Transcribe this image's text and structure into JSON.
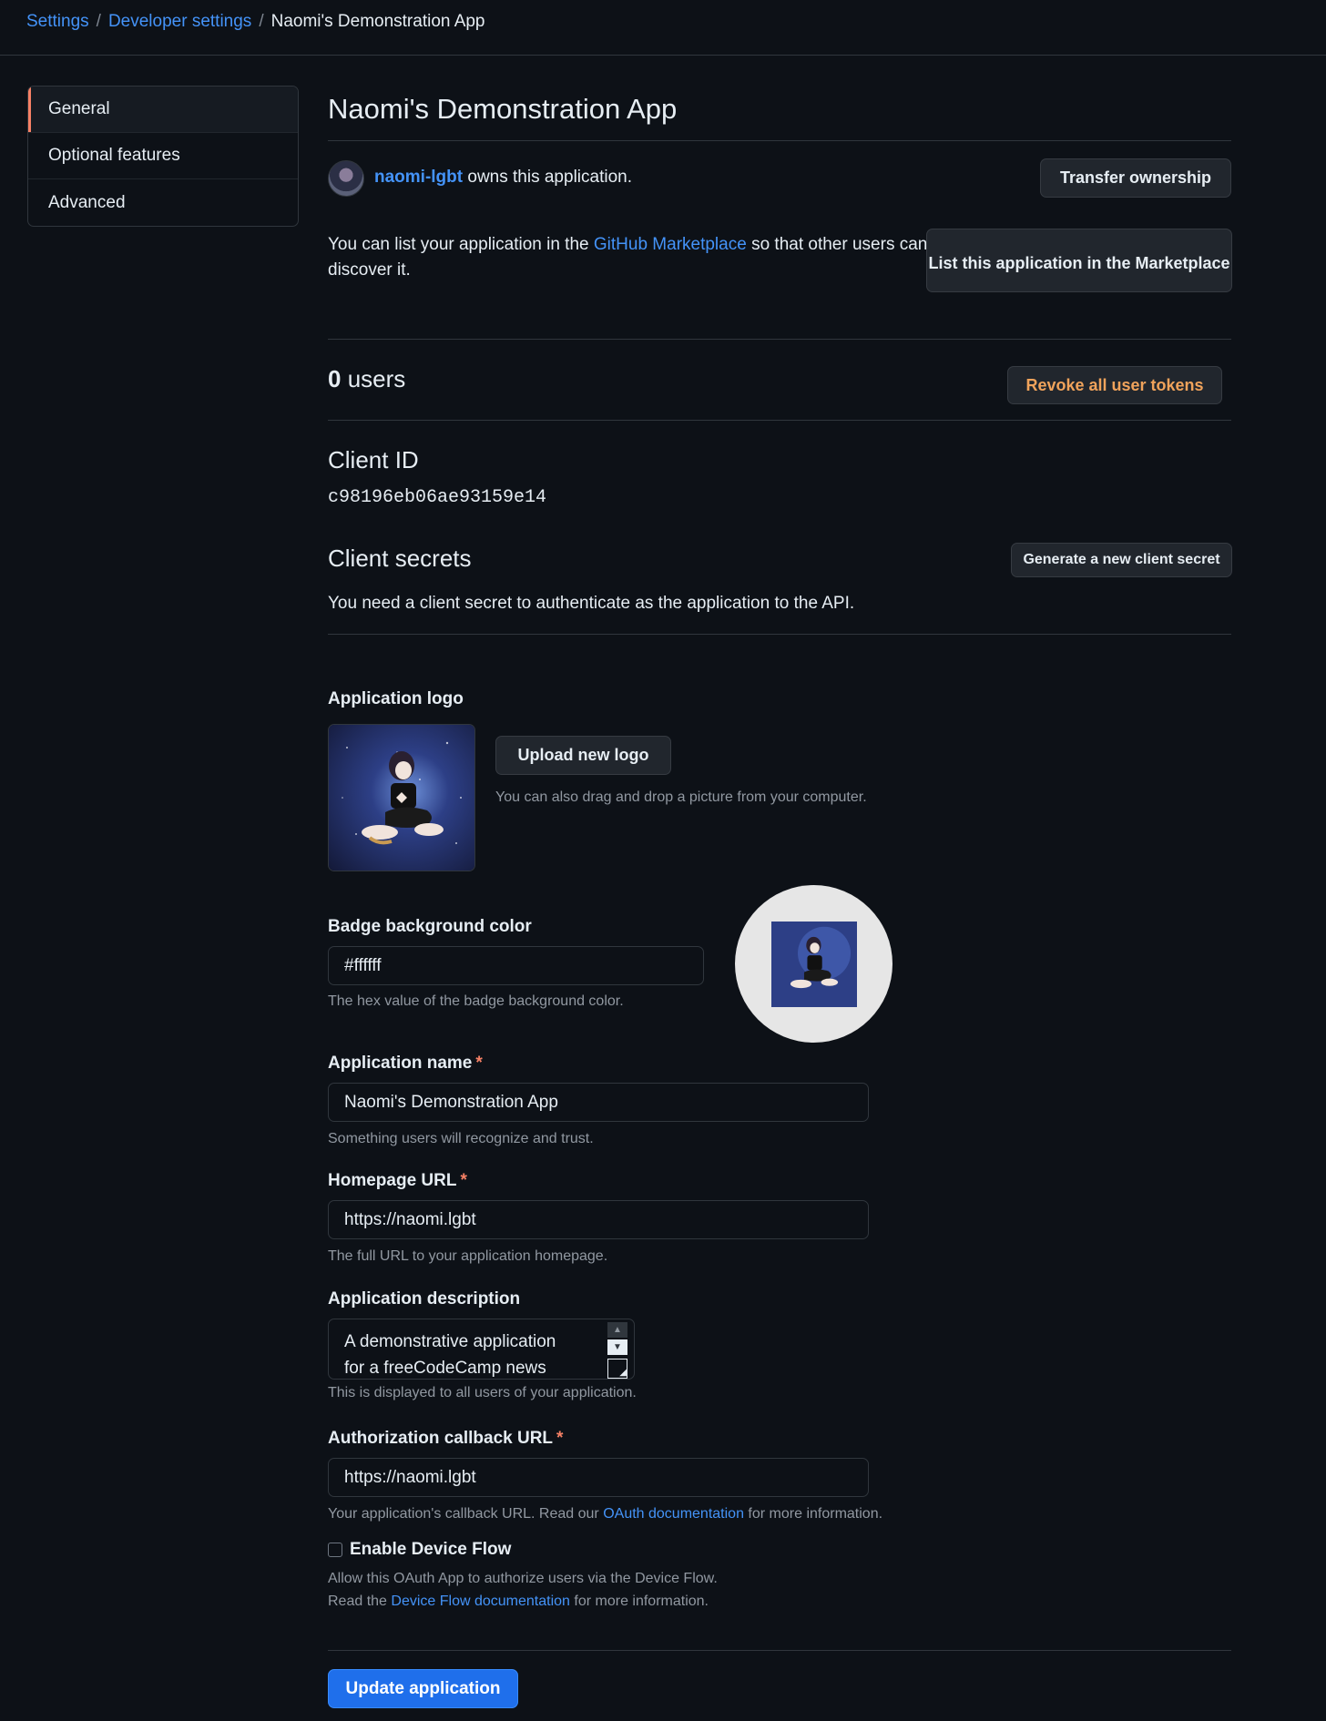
{
  "breadcrumb": {
    "settings": "Settings",
    "developer_settings": "Developer settings",
    "current": "Naomi's Demonstration App",
    "separator": "/"
  },
  "sidebar": {
    "items": [
      {
        "label": "General",
        "selected": true
      },
      {
        "label": "Optional features",
        "selected": false
      },
      {
        "label": "Advanced",
        "selected": false
      }
    ]
  },
  "app": {
    "title": "Naomi's Demonstration App",
    "owner": "naomi-lgbt",
    "owner_suffix": "owns this application.",
    "transfer_label": "Transfer ownership"
  },
  "marketplace": {
    "text_before": "You can list your application in the",
    "link": "GitHub Marketplace",
    "text_after": "so that other users can discover it.",
    "button_label": "List this application in the Marketplace"
  },
  "users": {
    "count": "0",
    "label": "users",
    "revoke_label": "Revoke all user tokens"
  },
  "client_id": {
    "label": "Client ID",
    "value": "c98196eb06ae93159e14"
  },
  "client_secrets": {
    "label": "Client secrets",
    "button_label": "Generate a new client secret",
    "description": "You need a client secret to authenticate as the application to the API."
  },
  "logo": {
    "label": "Application logo",
    "upload_label": "Upload new logo",
    "note": "You can also drag and drop a picture from your computer."
  },
  "badge": {
    "label": "Badge background color",
    "value": "#ffffff",
    "note": "The hex value of the badge background color."
  },
  "fields": {
    "app_name": {
      "label": "Application name",
      "required": "*",
      "value": "Naomi's Demonstration App",
      "note": "Something users will recognize and trust."
    },
    "homepage": {
      "label": "Homepage URL",
      "required": "*",
      "value": "https://naomi.lgbt",
      "note": "The full URL to your application homepage."
    },
    "description": {
      "label": "Application description",
      "value": "A demonstrative application for a freeCodeCamp news tutorial.",
      "note": "This is displayed to all users of your application."
    },
    "callback": {
      "label": "Authorization callback URL",
      "required": "*",
      "value": "https://naomi.lgbt",
      "note_before": "Your application's callback URL. Read our",
      "note_link": "OAuth documentation",
      "note_after": "for more information."
    }
  },
  "device_flow": {
    "label": "Enable Device Flow",
    "note1": "Allow this OAuth App to authorize users via the Device Flow.",
    "note2_before": "Read the",
    "note2_link": "Device Flow documentation",
    "note2_after": "for more information.",
    "checked": false
  },
  "update_label": "Update application",
  "colors": {
    "background": "#0d1117",
    "link": "#4493f8",
    "accent": "#f78166",
    "danger_text": "#f0a35b",
    "primary_button": "#1f6feb"
  }
}
